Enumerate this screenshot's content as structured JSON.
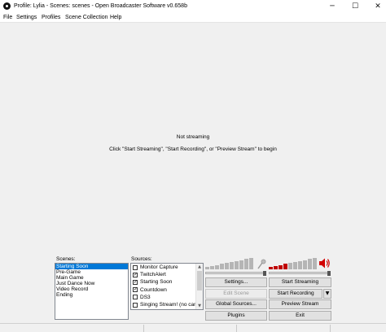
{
  "window": {
    "title": "Profile: Lylia - Scenes: scenes - Open Broadcaster Software v0.658b",
    "minimize_symbol": "─",
    "maximize_symbol": "☐",
    "close_symbol": "✕"
  },
  "menu": [
    "File",
    "Settings",
    "Profiles",
    "Scene Collection",
    "Help"
  ],
  "preview": {
    "status": "Not streaming",
    "hint": "Click \"Start Streaming\", \"Start Recording\", or \"Preview Stream\" to begin"
  },
  "scenes": {
    "label": "Scenes:",
    "items": [
      "Starting Soon",
      "Pre-Game",
      "Main Game",
      "Just Dance Now",
      "Video Record",
      "Ending"
    ],
    "selected": "Starting Soon"
  },
  "sources": {
    "label": "Sources:",
    "items": [
      {
        "label": "Monitor Capture",
        "checked": false
      },
      {
        "label": "TwitchAlert",
        "checked": true
      },
      {
        "label": "Starting Soon",
        "checked": true
      },
      {
        "label": "Countdown",
        "checked": true
      },
      {
        "label": "DS3",
        "checked": false
      },
      {
        "label": "Singing Stream! (no cam c",
        "checked": false
      }
    ]
  },
  "audio": {
    "mic_level": 0.0,
    "desktop_level": 0.35,
    "muted_icon": "mic-muted-icon",
    "speaker_icon": "speaker-icon",
    "meter_color": "#b5b5b5",
    "active_color": "#c00000"
  },
  "buttons": {
    "settings": "Settings...",
    "start_streaming": "Start Streaming",
    "edit_scene": "Edit Scene",
    "start_recording": "Start Recording",
    "global_sources": "Global Sources...",
    "preview_stream": "Preview Stream",
    "plugins": "Plugins",
    "exit": "Exit",
    "recording_dropdown": "▼"
  }
}
